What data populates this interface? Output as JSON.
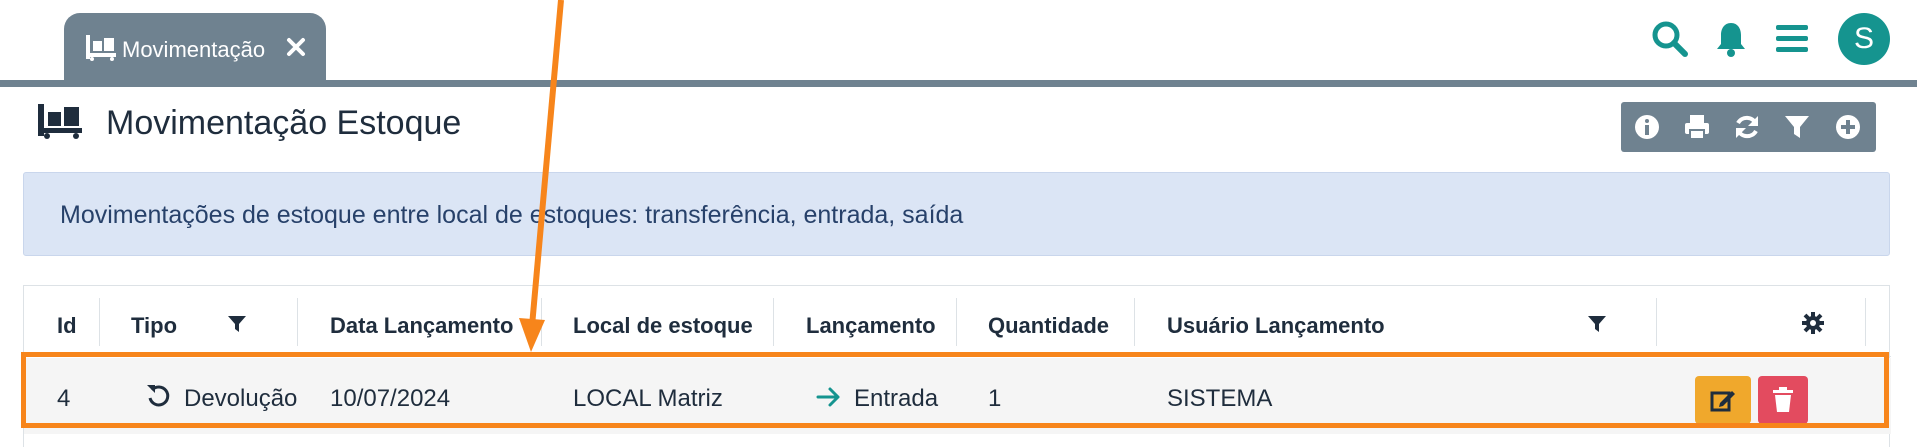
{
  "tab": {
    "label": "Movimentação"
  },
  "header": {
    "title": "Movimentação Estoque"
  },
  "info": {
    "text": "Movimentações de estoque entre local de estoques: transferência, entrada, saída"
  },
  "user": {
    "initial": "S"
  },
  "colors": {
    "accent": "#15948f",
    "tab": "#6f8290",
    "info_bg": "#dbe5f5",
    "highlight": "#f7851b",
    "edit": "#f0a82c",
    "delete": "#e34b5f"
  },
  "table": {
    "columns": [
      "Id",
      "Tipo",
      "Data Lançamento",
      "Local de estoque",
      "Lançamento",
      "Quantidade",
      "Usuário Lançamento"
    ],
    "rows": [
      {
        "id": "4",
        "tipo": "Devolução",
        "data": "10/07/2024",
        "local": "LOCAL Matriz",
        "lancamento": "Entrada",
        "quantidade": "1",
        "usuario": "SISTEMA"
      }
    ]
  }
}
